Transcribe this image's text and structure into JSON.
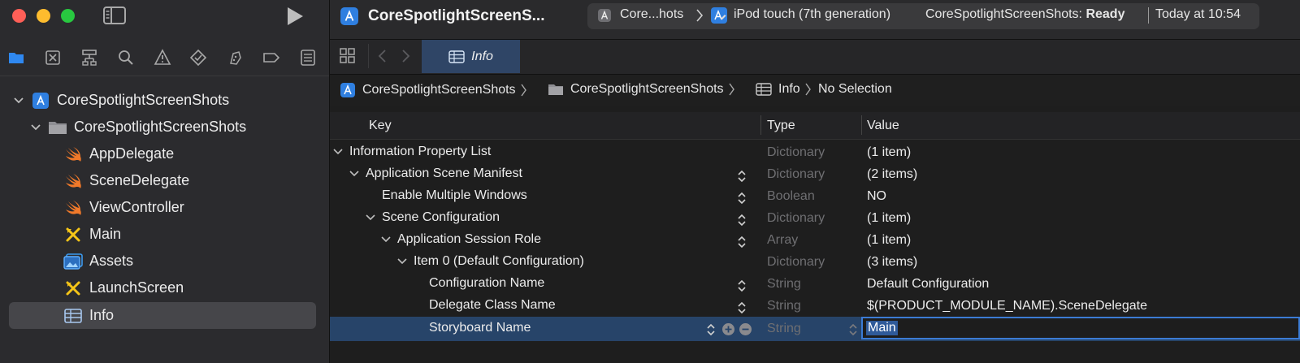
{
  "window": {
    "traffic_lights": [
      "#ff5f57",
      "#febc2e",
      "#28c840"
    ]
  },
  "toolbar": {
    "app_title": "CoreSpotlightScreenS...",
    "scheme": "Core...hots",
    "destination": "iPod touch (7th generation)",
    "status_prefix": "CoreSpotlightScreenShots:",
    "status_state": "Ready",
    "status_time": "Today at 10:54"
  },
  "navigator_icons": [
    "folder-icon",
    "source-control-icon",
    "symbol-icon",
    "find-icon",
    "issue-icon",
    "test-icon",
    "debug-icon",
    "breakpoint-icon",
    "report-icon"
  ],
  "project_tree": [
    {
      "label": "CoreSpotlightScreenShots",
      "icon": "project-icon",
      "level": 0
    },
    {
      "label": "CoreSpotlightScreenShots",
      "icon": "folder-icon",
      "level": 1
    },
    {
      "label": "AppDelegate",
      "icon": "swift-icon",
      "level": 2
    },
    {
      "label": "SceneDelegate",
      "icon": "swift-icon",
      "level": 2
    },
    {
      "label": "ViewController",
      "icon": "swift-icon",
      "level": 2
    },
    {
      "label": "Main",
      "icon": "storyboard-icon",
      "level": 2
    },
    {
      "label": "Assets",
      "icon": "assets-icon",
      "level": 2
    },
    {
      "label": "LaunchScreen",
      "icon": "storyboard-icon",
      "level": 2
    },
    {
      "label": "Info",
      "icon": "plist-icon",
      "level": 2
    }
  ],
  "tab": {
    "label": "Info"
  },
  "breadcrumb": {
    "project": "CoreSpotlightScreenShots",
    "group": "CoreSpotlightScreenShots",
    "file": "Info",
    "selection": "No Selection"
  },
  "table": {
    "headers": {
      "key": "Key",
      "type": "Type",
      "value": "Value"
    },
    "rows": [
      {
        "key": "Information Property List",
        "type": "Dictionary",
        "value": "(1 item)"
      },
      {
        "key": "Application Scene Manifest",
        "type": "Dictionary",
        "value": "(2 items)"
      },
      {
        "key": "Enable Multiple Windows",
        "type": "Boolean",
        "value": "NO"
      },
      {
        "key": "Scene Configuration",
        "type": "Dictionary",
        "value": "(1 item)"
      },
      {
        "key": "Application Session Role",
        "type": "Array",
        "value": "(1 item)"
      },
      {
        "key": "Item 0 (Default Configuration)",
        "type": "Dictionary",
        "value": "(3 items)"
      },
      {
        "key": "Configuration Name",
        "type": "String",
        "value": "Default Configuration"
      },
      {
        "key": "Delegate Class Name",
        "type": "String",
        "value": "$(PRODUCT_MODULE_NAME).SceneDelegate"
      },
      {
        "key": "Storyboard Name",
        "type": "String",
        "value": "Main"
      }
    ]
  },
  "colors": {
    "accent": "#3b7bd4",
    "selection": "#274469",
    "swift": "#f0792a",
    "storyboard": "#f5c518",
    "project": "#2f7fe0"
  }
}
